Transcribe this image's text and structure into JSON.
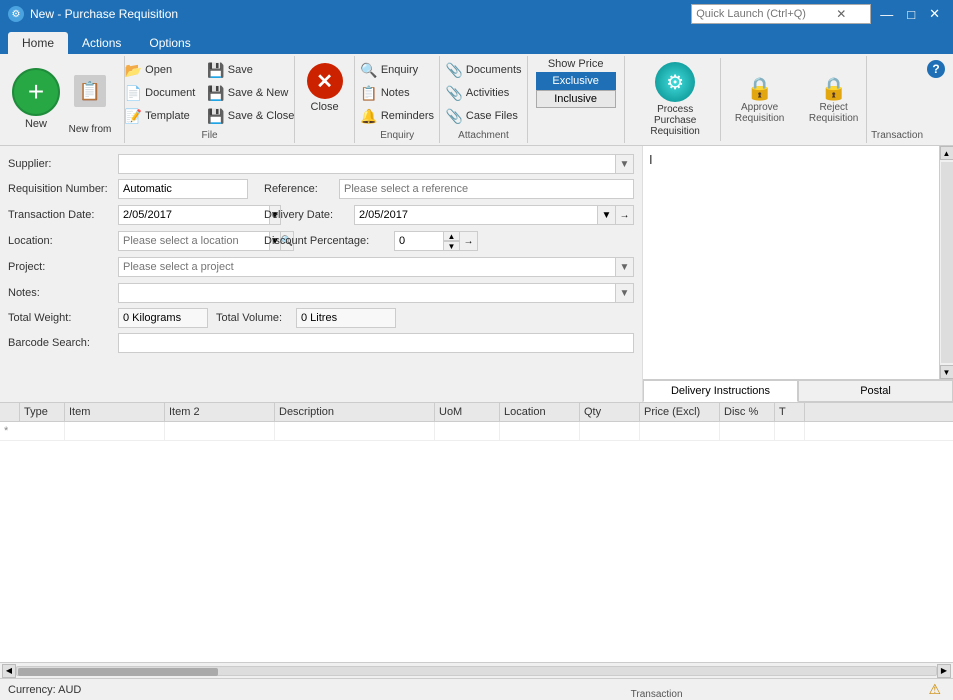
{
  "titleBar": {
    "icon": "⚙",
    "title": "New - Purchase Requisition",
    "searchPlaceholder": "Quick Launch (Ctrl+Q)",
    "winBtns": [
      "□",
      "—",
      "□",
      "✕"
    ]
  },
  "ribbonTabs": {
    "tabs": [
      "Home",
      "Actions",
      "Options"
    ],
    "activeTab": "Home"
  },
  "ribbon": {
    "groups": {
      "new": {
        "label": "New",
        "newFromLabel": "New from"
      },
      "file": {
        "label": "File",
        "open": "Open",
        "document": "Document",
        "template": "Template",
        "save": "Save",
        "saveAndNew": "Save & New",
        "saveAndClose": "Save & Close"
      },
      "close": {
        "label": "Close"
      },
      "enquiry": {
        "label": "Enquiry",
        "enquiry": "Enquiry",
        "notes": "Notes",
        "reminders": "Reminders"
      },
      "attachment": {
        "label": "Attachment",
        "documents": "Documents",
        "activities": "Activities",
        "caseFiles": "Case Files"
      },
      "showPrice": {
        "label": "Show Price",
        "exclusive": "Exclusive",
        "inclusive": "Inclusive"
      },
      "transaction": {
        "label": "Transaction",
        "process": "Process\nPurchase Requisition",
        "approve": "Approve\nRequisition",
        "reject": "Reject\nRequisition"
      }
    }
  },
  "form": {
    "supplierLabel": "Supplier:",
    "supplierPlaceholder": "",
    "requisitionLabel": "Requisition Number:",
    "requisitionValue": "Automatic",
    "referenceLabel": "Reference:",
    "referencePlaceholder": "Please select a reference",
    "transDateLabel": "Transaction Date:",
    "transDateValue": "2/05/2017",
    "deliveryDateLabel": "Delivery Date:",
    "deliveryDateValue": "2/05/2017",
    "locationLabel": "Location:",
    "locationPlaceholder": "Please select a location",
    "discountLabel": "Discount Percentage:",
    "discountValue": "0",
    "projectLabel": "Project:",
    "projectPlaceholder": "Please select a project",
    "notesLabel": "Notes:",
    "totalWeightLabel": "Total Weight:",
    "totalWeightValue": "0 Kilograms",
    "totalVolumeLabel": "Total Volume:",
    "totalVolumeValue": "0 Litres",
    "barcodeLabel": "Barcode Search:"
  },
  "grid": {
    "columns": [
      "Type",
      "Item",
      "Item 2",
      "Description",
      "UoM",
      "Location",
      "Qty",
      "Price (Excl)",
      "Disc %",
      "T"
    ],
    "rows": []
  },
  "rightPanel": {
    "cursorChar": "I",
    "tabs": [
      "Delivery Instructions",
      "Postal"
    ]
  },
  "statusBar": {
    "currency": "Currency: AUD",
    "warning": "⚠"
  },
  "scrollBar": {
    "leftArrow": "◀",
    "rightArrow": "▶"
  }
}
